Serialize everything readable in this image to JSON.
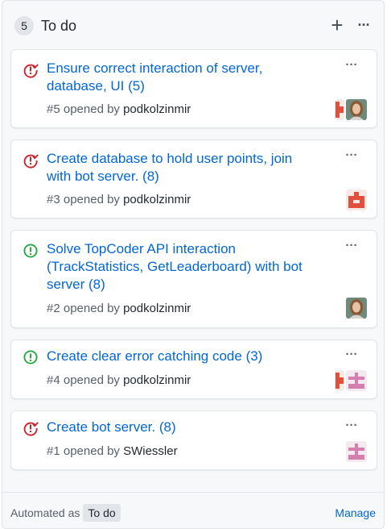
{
  "column": {
    "count": "5",
    "title": "To do",
    "add_symbol": "+",
    "more_symbol": "···"
  },
  "cards": [
    {
      "title": "Ensure correct interaction of server, database, UI (5)",
      "meta_prefix": "#5 opened by ",
      "author": "podkolzinmir",
      "state": "issue-closed-red",
      "state_color": "#cb2431",
      "avatars": [
        "identicon-red",
        "photo-woman"
      ]
    },
    {
      "title": "Create database to hold user points, join with bot server. (8)",
      "meta_prefix": "#3 opened by ",
      "author": "podkolzinmir",
      "state": "issue-closed-red",
      "state_color": "#cb2431",
      "avatars": [
        "identicon-red"
      ]
    },
    {
      "title": "Solve TopCoder API interaction (TrackStatistics, GetLeaderboard) with bot server (8)",
      "meta_prefix": "#2 opened by ",
      "author": "podkolzinmir",
      "state": "issue-open-green",
      "state_color": "#28a745",
      "avatars": [
        "photo-woman"
      ]
    },
    {
      "title": "Create clear error catching code (3)",
      "meta_prefix": "#4 opened by ",
      "author": "podkolzinmir",
      "state": "issue-open-green",
      "state_color": "#28a745",
      "avatars": [
        "identicon-red",
        "identicon-pink"
      ]
    },
    {
      "title": "Create bot server. (8)",
      "meta_prefix": "#1 opened by ",
      "author": "SWiessler",
      "state": "issue-closed-red",
      "state_color": "#cb2431",
      "avatars": [
        "identicon-pink"
      ]
    }
  ],
  "footer": {
    "automated_label": "Automated as",
    "automated_value": "To do",
    "manage_label": "Manage"
  },
  "colors": {
    "link": "#0366d6",
    "closed": "#cb2431",
    "open": "#28a745"
  }
}
